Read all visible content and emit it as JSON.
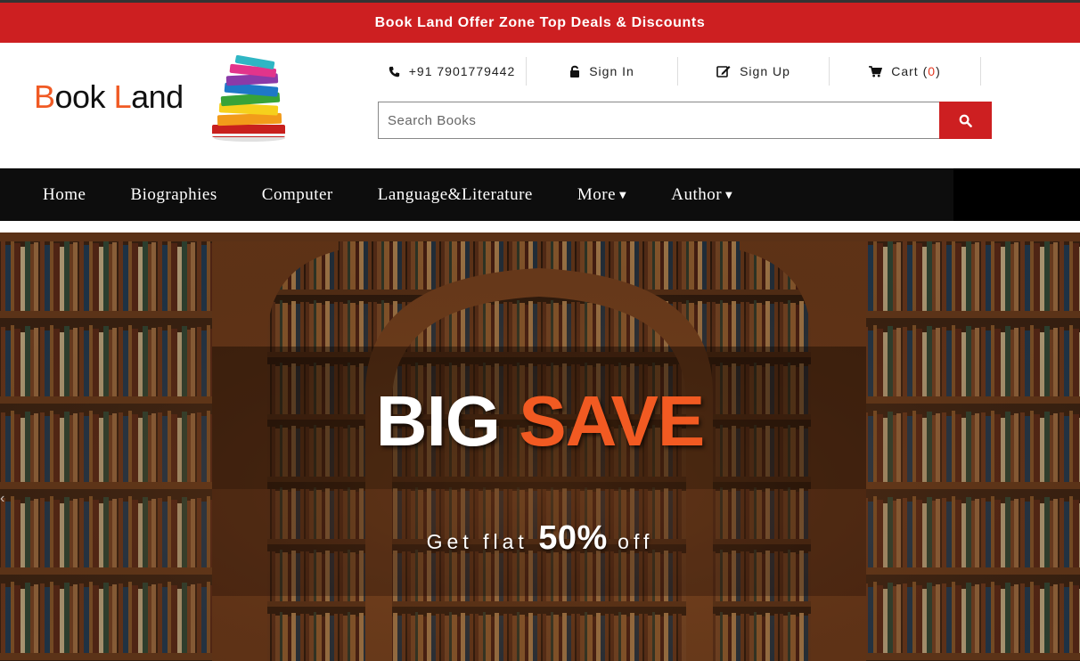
{
  "promo_bar": {
    "text": "Book Land Offer Zone Top Deals & Discounts"
  },
  "brand": {
    "first_letter": "B",
    "word1_rest": "ook",
    "second_letter": "L",
    "word2_rest": "and",
    "logo_icon": "books-stack-icon"
  },
  "contact": {
    "phone_icon": "phone-icon",
    "phone": "+91 7901779442"
  },
  "account": {
    "signin_icon": "lock-icon",
    "signin_label": "Sign In",
    "signup_icon": "edit-icon",
    "signup_label": "Sign Up",
    "cart_icon": "cart-icon",
    "cart_label": "Cart",
    "cart_open": "(",
    "cart_count": "0",
    "cart_close": ")"
  },
  "search": {
    "placeholder": "Search Books",
    "value": "",
    "button_icon": "search-icon"
  },
  "nav": {
    "items": [
      {
        "label": "Home"
      },
      {
        "label": "Biographies"
      },
      {
        "label": "Computer"
      },
      {
        "label": "Language&Literature"
      },
      {
        "label": "More",
        "dropdown": true
      },
      {
        "label": "Author",
        "dropdown": true
      }
    ]
  },
  "hero": {
    "headline_white": "BIG",
    "headline_orange": "SAVE",
    "sub_prefix": "Get flat",
    "sub_percent": "50%",
    "sub_suffix": "off"
  },
  "colors": {
    "accent_red": "#cd1f21",
    "brand_orange": "#f05a24",
    "nav_black": "#0d0d0d"
  }
}
